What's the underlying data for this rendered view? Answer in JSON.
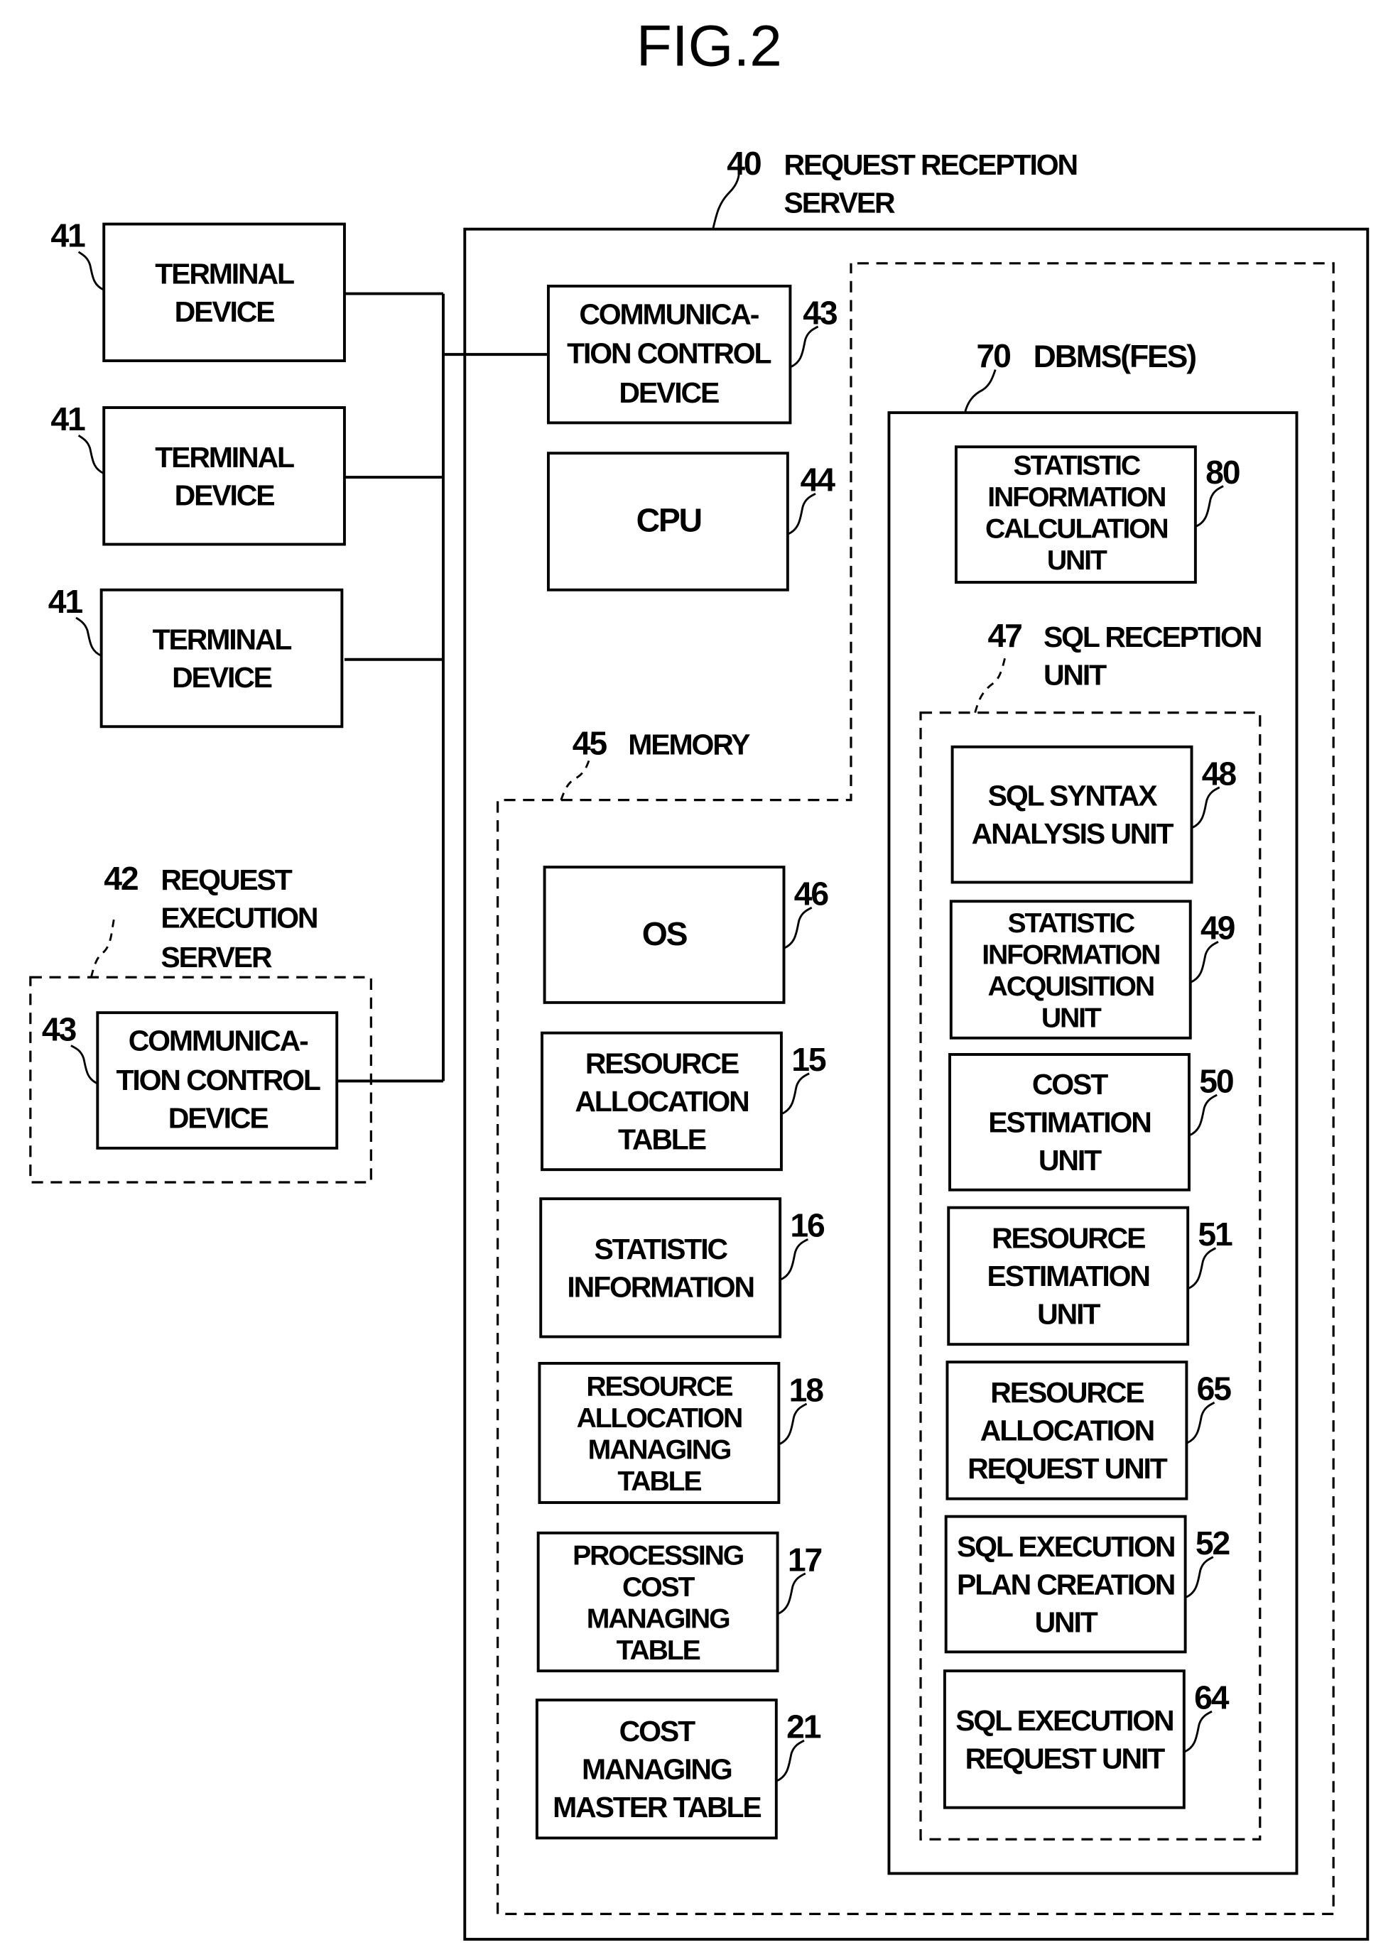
{
  "figure": {
    "title": "FIG.2"
  },
  "request_reception_server": {
    "ref": "40",
    "label_lines": [
      "REQUEST RECEPTION",
      "SERVER"
    ],
    "communication_control_device": {
      "ref": "43",
      "lines": [
        "COMMUNICA-",
        "TION CONTROL",
        "DEVICE"
      ]
    },
    "cpu": {
      "ref": "44",
      "lines": [
        "CPU"
      ]
    },
    "memory": {
      "ref": "45",
      "label": "MEMORY",
      "items": [
        {
          "ref": "46",
          "lines": [
            "OS"
          ]
        },
        {
          "ref": "15",
          "lines": [
            "RESOURCE",
            "ALLOCATION",
            "TABLE"
          ]
        },
        {
          "ref": "16",
          "lines": [
            "STATISTIC",
            "INFORMATION"
          ]
        },
        {
          "ref": "18",
          "lines": [
            "RESOURCE",
            "ALLOCATION",
            "MANAGING",
            "TABLE"
          ]
        },
        {
          "ref": "17",
          "lines": [
            "PROCESSING",
            "COST",
            "MANAGING",
            "TABLE"
          ]
        },
        {
          "ref": "21",
          "lines": [
            "COST",
            "MANAGING",
            "MASTER TABLE"
          ]
        }
      ]
    },
    "dbms": {
      "ref": "70",
      "label": "DBMS(FES)",
      "statistic_calc_unit": {
        "ref": "80",
        "lines": [
          "STATISTIC",
          "INFORMATION",
          "CALCULATION",
          "UNIT"
        ]
      },
      "sql_reception_unit": {
        "ref": "47",
        "label_lines": [
          "SQL RECEPTION",
          "UNIT"
        ],
        "units": [
          {
            "ref": "48",
            "lines": [
              "SQL SYNTAX",
              "ANALYSIS UNIT"
            ]
          },
          {
            "ref": "49",
            "lines": [
              "STATISTIC",
              "INFORMATION",
              "ACQUISITION",
              "UNIT"
            ]
          },
          {
            "ref": "50",
            "lines": [
              "COST",
              "ESTIMATION",
              "UNIT"
            ]
          },
          {
            "ref": "51",
            "lines": [
              "RESOURCE",
              "ESTIMATION",
              "UNIT"
            ]
          },
          {
            "ref": "65",
            "lines": [
              "RESOURCE",
              "ALLOCATION",
              "REQUEST UNIT"
            ]
          },
          {
            "ref": "52",
            "lines": [
              "SQL EXECUTION",
              "PLAN CREATION",
              "UNIT"
            ]
          },
          {
            "ref": "64",
            "lines": [
              "SQL EXECUTION",
              "REQUEST UNIT"
            ]
          }
        ]
      }
    }
  },
  "terminals": [
    {
      "ref": "41",
      "lines": [
        "TERMINAL",
        "DEVICE"
      ]
    },
    {
      "ref": "41",
      "lines": [
        "TERMINAL",
        "DEVICE"
      ]
    },
    {
      "ref": "41",
      "lines": [
        "TERMINAL",
        "DEVICE"
      ]
    }
  ],
  "request_execution_server": {
    "ref": "42",
    "label_lines": [
      "REQUEST",
      "EXECUTION",
      "SERVER"
    ],
    "communication_control_device": {
      "ref": "43",
      "lines": [
        "COMMUNICA-",
        "TION CONTROL",
        "DEVICE"
      ]
    }
  }
}
